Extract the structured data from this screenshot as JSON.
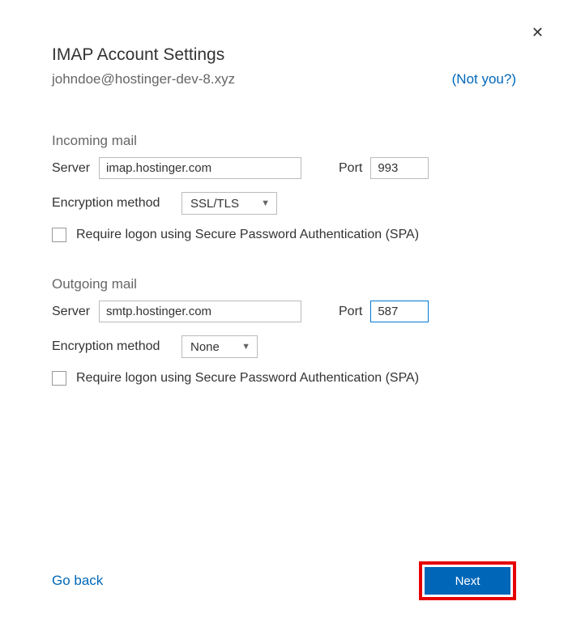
{
  "close_icon": "✕",
  "header": {
    "title": "IMAP Account Settings",
    "email": "johndoe@hostinger-dev-8.xyz",
    "not_you": "(Not you?)"
  },
  "incoming": {
    "title": "Incoming mail",
    "server_label": "Server",
    "server_value": "imap.hostinger.com",
    "port_label": "Port",
    "port_value": "993",
    "enc_label": "Encryption method",
    "enc_value": "SSL/TLS",
    "spa_label": "Require logon using Secure Password Authentication (SPA)"
  },
  "outgoing": {
    "title": "Outgoing mail",
    "server_label": "Server",
    "server_value": "smtp.hostinger.com",
    "port_label": "Port",
    "port_value": "587",
    "enc_label": "Encryption method",
    "enc_value": "None",
    "spa_label": "Require logon using Secure Password Authentication (SPA)"
  },
  "footer": {
    "go_back": "Go back",
    "next": "Next"
  }
}
